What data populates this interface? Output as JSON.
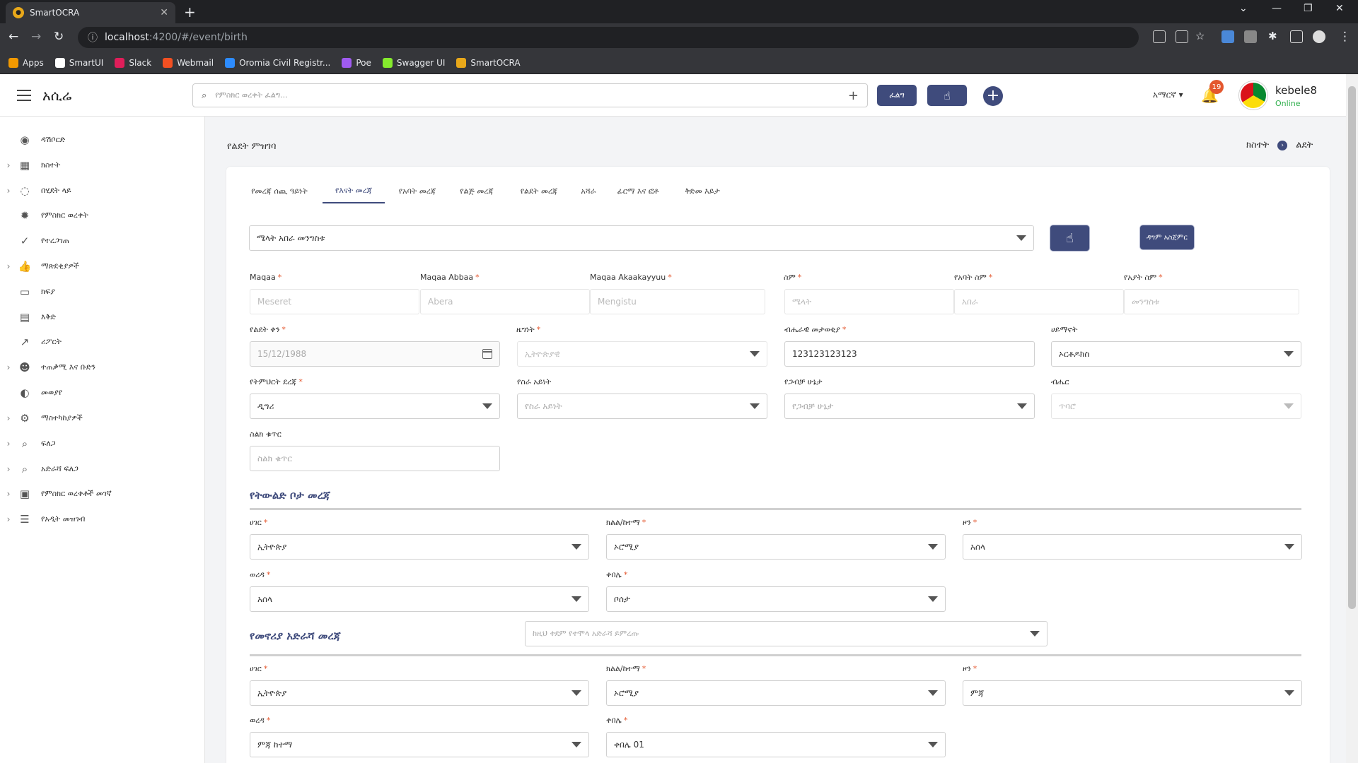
{
  "browser": {
    "tab_title": "SmartOCRA",
    "url_host": "localhost",
    "url_path": ":4200/#/event/birth",
    "bookmarks": [
      {
        "label": "Apps",
        "color": "#f29900"
      },
      {
        "label": "SmartUI",
        "color": "#ffffff"
      },
      {
        "label": "Slack",
        "color": "#e01e5a"
      },
      {
        "label": "Webmail",
        "color": "#f25022"
      },
      {
        "label": "Oromia Civil Registr...",
        "color": "#2d8cff"
      },
      {
        "label": "Poe",
        "color": "#a05bf0"
      },
      {
        "label": "Swagger UI",
        "color": "#85ea2d"
      },
      {
        "label": "SmartOCRA",
        "color": "#e8a81a"
      }
    ]
  },
  "header": {
    "brand": "አሲሬ",
    "search_placeholder": "የምስክር ወረቀት ፈልግ...",
    "search_btn": "ፈልግ",
    "lang": "አማርኛ ▾",
    "notif_count": "19",
    "user_name": "kebele8",
    "user_status": "Online"
  },
  "sidebar": {
    "items": [
      {
        "label": "ዳሽቦርድ",
        "icon": "dashboard-icon",
        "glyph": "◉",
        "chev": ""
      },
      {
        "label": "ክስተት",
        "icon": "calendar-icon",
        "glyph": "▦",
        "chev": "›"
      },
      {
        "label": "በሂደት ላይ",
        "icon": "spinner-icon",
        "glyph": "◌",
        "chev": "›"
      },
      {
        "label": "የምስክር ወረቀት",
        "icon": "certificate-icon",
        "glyph": "✹",
        "chev": ""
      },
      {
        "label": "የተረጋገጠ",
        "icon": "check-circle-icon",
        "glyph": "✓",
        "chev": ""
      },
      {
        "label": "ማጽደቂያዎች",
        "icon": "thumbs-up-icon",
        "glyph": "👍",
        "chev": "›"
      },
      {
        "label": "ክፍያ",
        "icon": "credit-card-icon",
        "glyph": "▭",
        "chev": ""
      },
      {
        "label": "እቅድ",
        "icon": "calendar-plan-icon",
        "glyph": "▤",
        "chev": ""
      },
      {
        "label": "ሪፖርት",
        "icon": "chart-line-icon",
        "glyph": "↗",
        "chev": ""
      },
      {
        "label": "ተጠቃሚ እና ቡድን",
        "icon": "users-icon",
        "glyph": "☻",
        "chev": "›"
      },
      {
        "label": "መወያየ",
        "icon": "chat-icon",
        "glyph": "◐",
        "chev": ""
      },
      {
        "label": "ማስተካከያዎች",
        "icon": "gear-icon",
        "glyph": "⚙",
        "chev": "›"
      },
      {
        "label": "ፍለጋ",
        "icon": "search-icon",
        "glyph": "⌕",
        "chev": "›"
      },
      {
        "label": "አድራሻ ፍለጋ",
        "icon": "search-plus-icon",
        "glyph": "⌕",
        "chev": "›"
      },
      {
        "label": "የምስክር ወረቀቶች መገኛ",
        "icon": "archive-icon",
        "glyph": "▣",
        "chev": "›"
      },
      {
        "label": "የአዲት መዝገብ",
        "icon": "list-icon",
        "glyph": "☰",
        "chev": "›"
      }
    ]
  },
  "page": {
    "title": "የልደት ምዝገባ",
    "crumb_parent": "ክስተት",
    "crumb_current": "ልደት"
  },
  "tabs": [
    "የመረጃ ሰጪ ዓይነት",
    "የእናት መረጃ",
    "የአባት መረጃ",
    "የልጅ መረጃ",
    "የልደት መረጃ",
    "አሻራ",
    "ፊርማ እና ፎቶ",
    "ቅድመ እይታ"
  ],
  "form": {
    "person_select": "ሜላት አበራ መንግስቱ",
    "fingerprint_btn": "☝",
    "camera_btn": "ዳግም አስጀምር",
    "labels": {
      "maqaa": "Maqaa",
      "maqaa_abbaa": "Maqaa Abbaa",
      "maqaa_akaakayyuu": "Maqaa Akaakayyuu",
      "name": "ስም",
      "father_name": "የአባት ስም",
      "grandfather_name": "የአያት ስም",
      "birth_date": "የልደት ቀን",
      "nationality": "ዜግነት",
      "national_id": "ብሔራዊ መታወቂያ",
      "religion": "ሀይማኖት",
      "education": "የትምህርት ደረጃ",
      "occupation": "የስራ አይነት",
      "marital_status": "የጋብቻ ሁኔታ",
      "ethnicity": "ብሔር",
      "phone": "ስልክ ቁጥር"
    },
    "values": {
      "maqaa": "Meseret",
      "maqaa_abbaa": "Abera",
      "maqaa_akaakayyuu": "Mengistu",
      "name": "ሜላት",
      "father_name": "አበራ",
      "grandfather_name": "መንግስቱ",
      "birth_date": "15/12/1988",
      "nationality": "ኢትዮጵያዊ",
      "national_id": "123123123123",
      "religion": "ኦርቶዶክስ",
      "education": "ዲግሪ",
      "occupation_placeholder": "የስራ አይነት",
      "marital_placeholder": "የጋብቻ ሁኔታ",
      "ethnicity_placeholder": "ጥባሮ",
      "phone_placeholder": "ስልክ ቁጥር"
    }
  },
  "birthplace": {
    "title": "የትውልድ ቦታ መረጃ",
    "labels": {
      "country": "ሀገር",
      "region": "ክልል/ከተማ",
      "zone": "ዞን",
      "woreda": "ወረዳ",
      "kebele": "ቀበሌ"
    },
    "values": {
      "country": "ኢትዮጵያ",
      "region": "ኦሮሚያ",
      "zone": "አሰላ",
      "woreda": "አሰላ",
      "kebele": "ቦሰታ"
    }
  },
  "residence": {
    "title": "የመኖሪያ አድራሻ መረጃ",
    "copy_placeholder": "ከዚህ ቀደም የተሞላ አድራሻ ይምረጡ",
    "labels": {
      "country": "ሀገር",
      "region": "ክልል/ከተማ",
      "zone": "ዞን",
      "woreda": "ወረዳ",
      "kebele": "ቀበሌ"
    },
    "values": {
      "country": "ኢትዮጵያ",
      "region": "ኦሮሚያ",
      "zone": "ምጃ",
      "woreda": "ምጃ ከተማ",
      "kebele": "ቀበሌ 01"
    }
  }
}
